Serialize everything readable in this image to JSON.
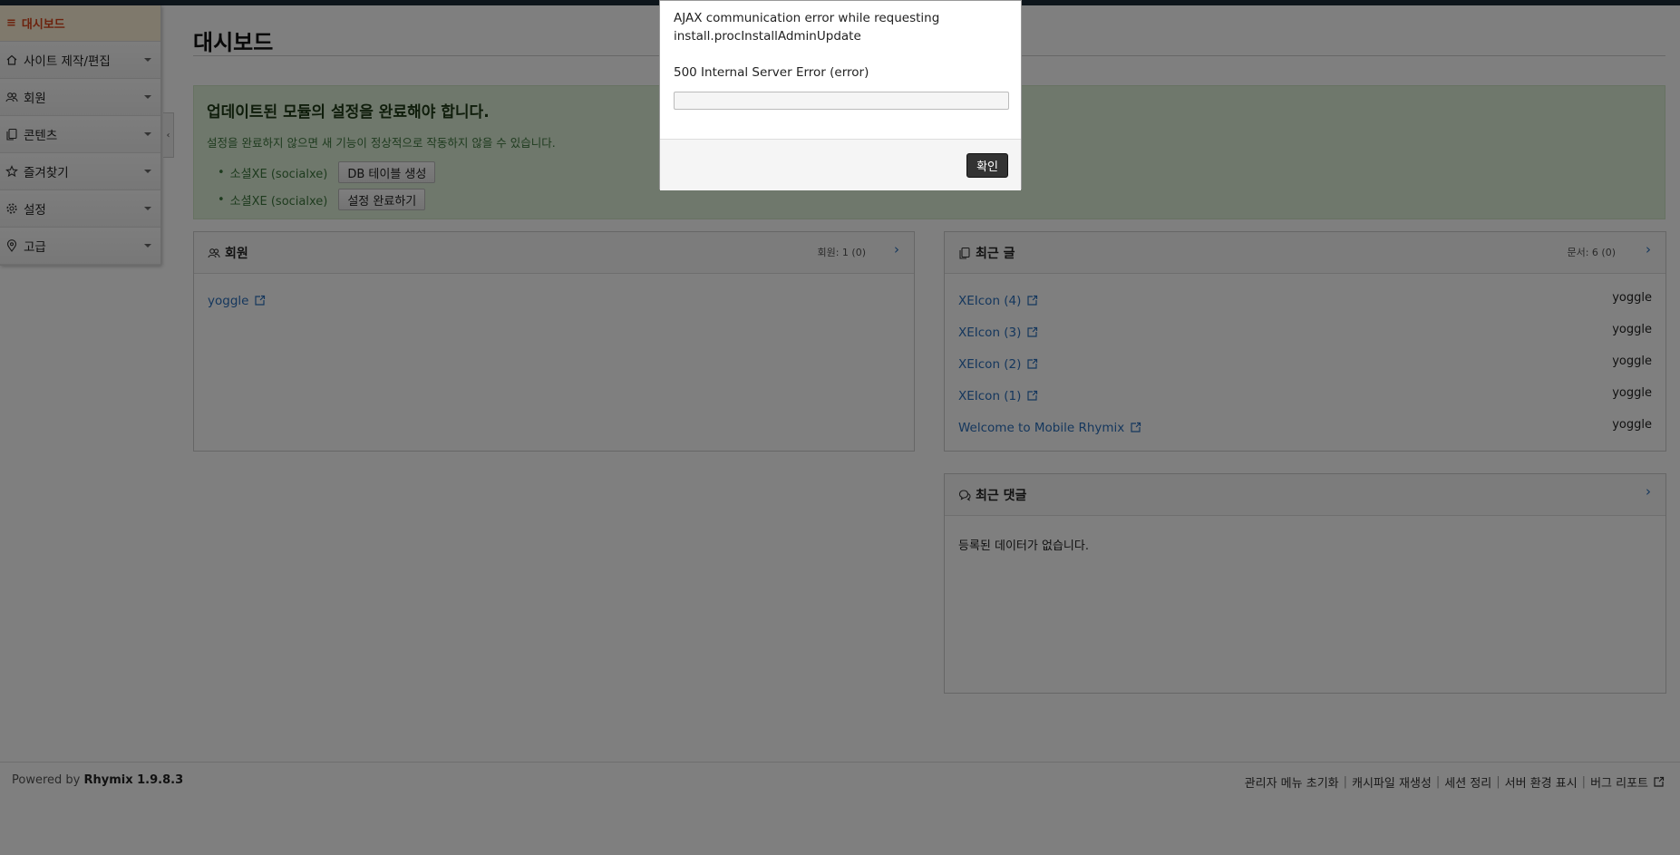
{
  "sidebar": {
    "header_icon": "≡",
    "header_label": "대시보드",
    "items": [
      {
        "label": "사이트 제작/편집",
        "icon": "home-icon"
      },
      {
        "label": "회원",
        "icon": "users-icon"
      },
      {
        "label": "콘텐츠",
        "icon": "copy-icon"
      },
      {
        "label": "즐겨찾기",
        "icon": "star-icon"
      },
      {
        "label": "설정",
        "icon": "gear-icon"
      },
      {
        "label": "고급",
        "icon": "pin-icon"
      }
    ],
    "collapse_glyph": "‹"
  },
  "main": {
    "title": "대시보드",
    "notice": {
      "heading": "업데이트된 모듈의 설정을 완료해야 합니다.",
      "description": "설정을 완료하지 않으면 새 기능이 정상적으로 작동하지 않을 수 있습니다.",
      "modules": [
        {
          "bullet": "•",
          "name": "소셜XE (socialxe)",
          "button": "DB 테이블 생성"
        },
        {
          "bullet": "•",
          "name": "소셜XE (socialxe)",
          "button": "설정 완료하기"
        }
      ]
    },
    "members_panel": {
      "title": "회원",
      "count": "회원: 1 (0)",
      "more": "›",
      "items": [
        {
          "label": "yoggle"
        }
      ]
    },
    "recent_posts_panel": {
      "title": "최근 글",
      "count": "문서: 6 (0)",
      "more": "›",
      "items": [
        {
          "title": "XEIcon (4)",
          "author": "yoggle"
        },
        {
          "title": "XEIcon (3)",
          "author": "yoggle"
        },
        {
          "title": "XEIcon (2)",
          "author": "yoggle"
        },
        {
          "title": "XEIcon (1)",
          "author": "yoggle"
        },
        {
          "title": "Welcome to Mobile Rhymix",
          "author": "yoggle"
        }
      ]
    },
    "recent_comments_panel": {
      "title": "최근 댓글",
      "more": "›",
      "empty_text": "등록된 데이터가 없습니다."
    }
  },
  "footer": {
    "powered_prefix": "Powered by ",
    "powered_name": "Rhymix 1.9.8.3",
    "links": [
      "관리자 메뉴 초기화",
      "캐시파일 재생성",
      "세션 정리",
      "서버 환경 표시",
      "버그 리포트"
    ],
    "separator": "|"
  },
  "modal": {
    "message": "AJAX communication error while requesting\ninstall.procInstallAdminUpdate",
    "error": "500 Internal Server Error (error)",
    "progress": 0,
    "confirm_label": "확인"
  },
  "colors": {
    "topbar": "#1b2a37",
    "sidebar_active": "#d9441a",
    "notice_bg": "#dff0d8",
    "link": "#2a6ebb"
  }
}
